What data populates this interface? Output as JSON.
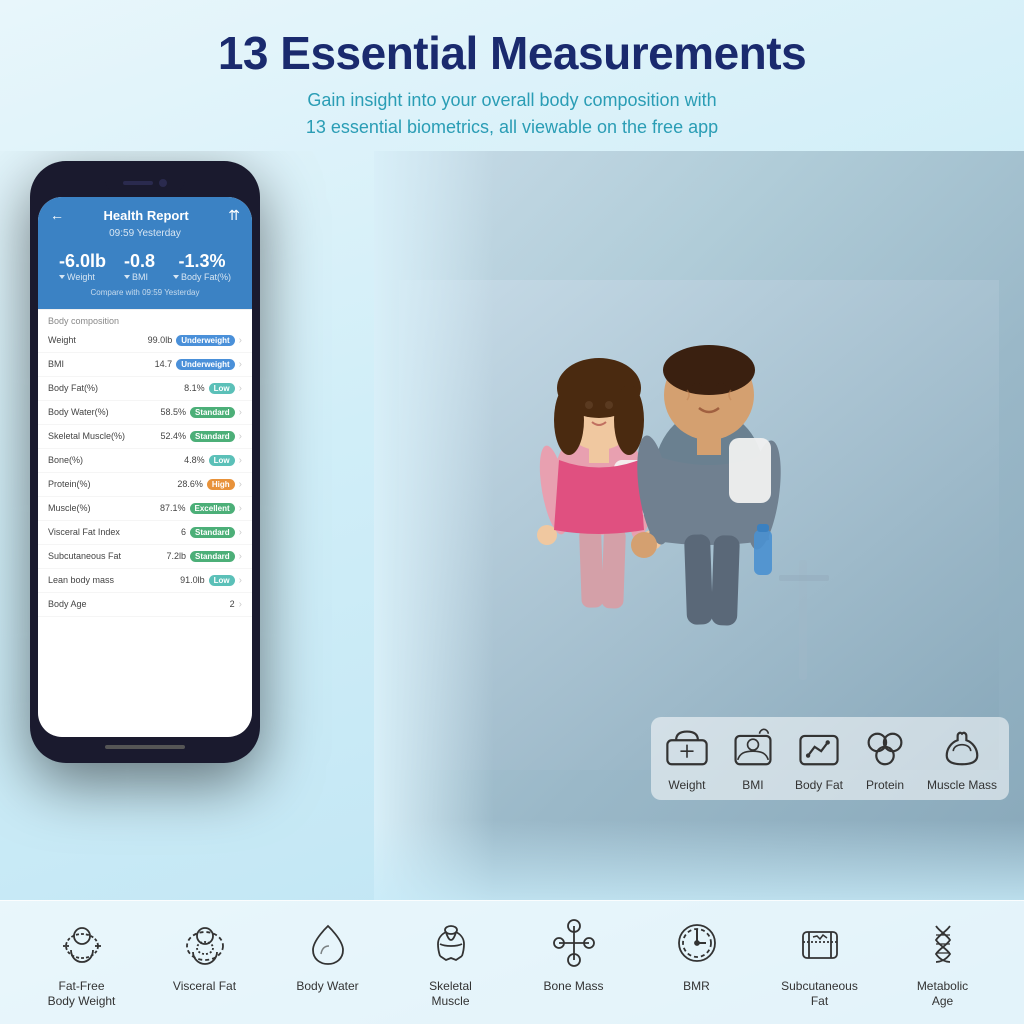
{
  "page": {
    "title": "13 Essential Measurements",
    "subtitle_line1": "Gain insight into your overall body composition with",
    "subtitle_line2": "13 essential biometrics, all viewable on the free app"
  },
  "app": {
    "header_title": "Health Report",
    "time": "09:59 Yesterday",
    "compare_text": "Compare with 09:59 Yesterday",
    "stats": [
      {
        "value": "-6.0lb",
        "label": "Weight"
      },
      {
        "value": "-0.8",
        "label": "BMI"
      },
      {
        "value": "-1.3%",
        "label": "Body Fat(%)"
      }
    ],
    "section_title": "Body composition",
    "rows": [
      {
        "label": "Weight",
        "value": "99.0lb",
        "badge": "Underweight",
        "badge_type": "blue"
      },
      {
        "label": "BMI",
        "value": "14.7",
        "badge": "Underweight",
        "badge_type": "blue"
      },
      {
        "label": "Body Fat(%)",
        "value": "8.1%",
        "badge": "Low",
        "badge_type": "low"
      },
      {
        "label": "Body Water(%)",
        "value": "58.5%",
        "badge": "Standard",
        "badge_type": "green"
      },
      {
        "label": "Skeletal Muscle(%)",
        "value": "52.4%",
        "badge": "Standard",
        "badge_type": "green"
      },
      {
        "label": "Bone(%)",
        "value": "4.8%",
        "badge": "Low",
        "badge_type": "low"
      },
      {
        "label": "Protein(%)",
        "value": "28.6%",
        "badge": "High",
        "badge_type": "orange"
      },
      {
        "label": "Muscle(%)",
        "value": "87.1%",
        "badge": "Excellent",
        "badge_type": "green"
      },
      {
        "label": "Visceral Fat Index",
        "value": "6",
        "badge": "Standard",
        "badge_type": "green"
      },
      {
        "label": "Subcutaneous Fat",
        "value": "7.2lb",
        "badge": "Standard",
        "badge_type": "green"
      },
      {
        "label": "Lean body mass",
        "value": "91.0lb",
        "badge": "Low",
        "badge_type": "low"
      },
      {
        "label": "Body Age",
        "value": "2",
        "badge": "",
        "badge_type": ""
      }
    ]
  },
  "top_icons": [
    {
      "id": "weight-icon",
      "label": "Weight"
    },
    {
      "id": "bmi-icon",
      "label": "BMI"
    },
    {
      "id": "body-fat-icon",
      "label": "Body Fat"
    },
    {
      "id": "protein-icon",
      "label": "Protein"
    },
    {
      "id": "muscle-mass-icon",
      "label": "Muscle Mass"
    }
  ],
  "bottom_icons": [
    {
      "id": "fat-free-icon",
      "label": "Fat-Free\nBody Weight"
    },
    {
      "id": "visceral-fat-icon",
      "label": "Visceral Fat"
    },
    {
      "id": "body-water-icon",
      "label": "Body Water"
    },
    {
      "id": "skeletal-muscle-icon",
      "label": "Skeletal\nMuscle"
    },
    {
      "id": "bone-mass-icon",
      "label": "Bone Mass"
    },
    {
      "id": "bmr-icon",
      "label": "BMR"
    },
    {
      "id": "subcutaneous-fat-icon",
      "label": "Subcutaneous\nFat"
    },
    {
      "id": "metabolic-age-icon",
      "label": "Metabolic\nAge"
    }
  ]
}
